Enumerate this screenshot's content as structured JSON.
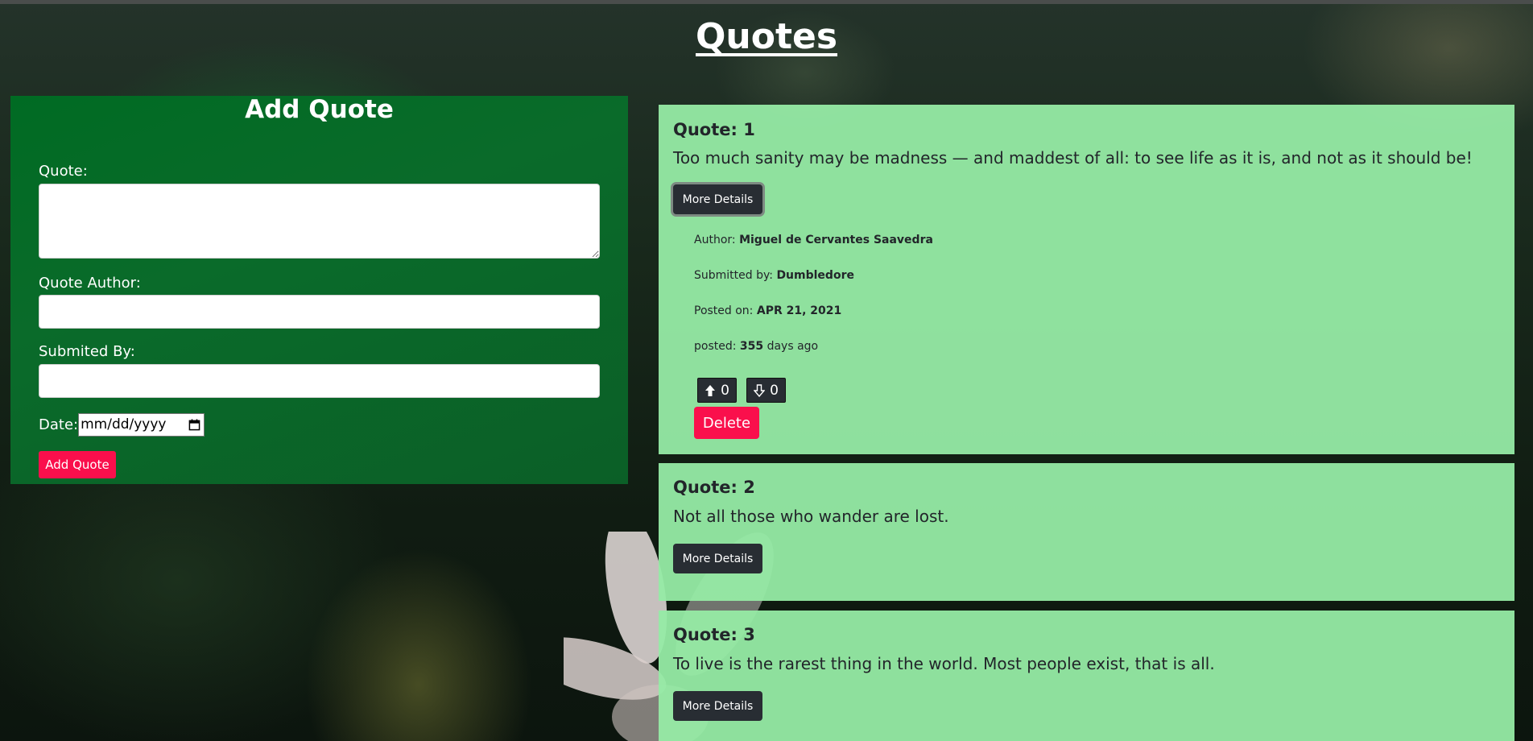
{
  "page": {
    "title": "Quotes"
  },
  "form": {
    "title": "Add Quote",
    "quote_label": "Quote:",
    "author_label": "Quote Author:",
    "submitted_label": "Submited By:",
    "date_label": "Date:",
    "date_placeholder": "mm/dd/yyyy",
    "submit_label": "Add Quote"
  },
  "quotes": [
    {
      "title": "Quote: 1",
      "text": "Too much sanity may be madness — and maddest of all: to see life as it is, and not as it should be!",
      "details_label": "More Details",
      "author_label": "Author:",
      "author": "Miguel de Cervantes Saavedra",
      "submitted_label": "Submitted by:",
      "submitted_by": "Dumbledore",
      "posted_on_label": "Posted on:",
      "posted_on": "APR 21, 2021",
      "posted_label": "posted:",
      "posted_ago": "355",
      "posted_suffix": "days ago",
      "upvotes": "0",
      "downvotes": "0",
      "delete_label": "Delete"
    },
    {
      "title": "Quote: 2",
      "text": "Not all those who wander are lost.",
      "details_label": "More Details"
    },
    {
      "title": "Quote: 3",
      "text": "To live is the rarest thing in the world. Most people exist, that is all.",
      "details_label": "More Details"
    }
  ],
  "colors": {
    "form_bg": "#006b23",
    "card_bg": "#96eba5",
    "danger": "#fa0f4c",
    "dark_button": "#282d33"
  },
  "icons": {
    "upvote": "arrow-up-icon",
    "downvote": "arrow-down-icon",
    "calendar": "calendar-icon"
  }
}
